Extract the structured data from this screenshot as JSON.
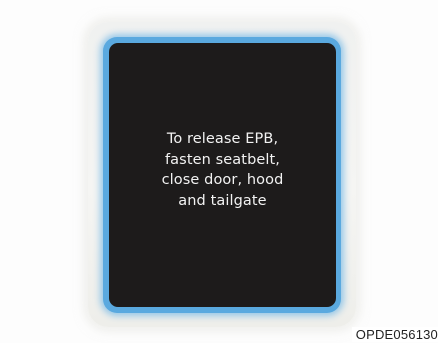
{
  "display": {
    "message_lines": [
      "To release EPB,",
      "fasten seatbelt,",
      "close door, hood",
      "and tailgate"
    ]
  },
  "image_code": "OPDE056130",
  "colors": {
    "screen": "#1d1b1b",
    "bezel_glow": "#5aa9df",
    "text": "#f2f2f2"
  }
}
